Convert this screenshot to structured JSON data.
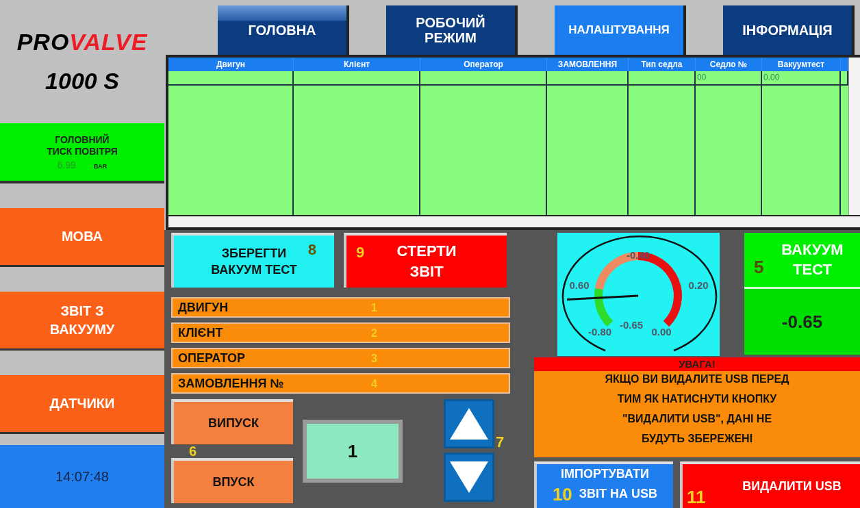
{
  "logo": {
    "brand_prefix": "PRO",
    "brand_suffix": "VALVE",
    "model": "1000 S"
  },
  "nav": [
    {
      "label": "ГОЛОВНА",
      "selected": false
    },
    {
      "label": "РОБОЧИЙ\nРЕЖИМ",
      "selected": false
    },
    {
      "label": "НАЛАШТУВАННЯ",
      "selected": true
    },
    {
      "label": "ІНФОРМАЦІЯ",
      "selected": false
    }
  ],
  "pressure": {
    "title": "ГОЛОВНИЙ\nТИСК ПОВІТРЯ",
    "value": "6.99",
    "unit": "BAR"
  },
  "side_buttons": [
    {
      "label": "МОВА"
    },
    {
      "label": "ЗВІТ З\nВАКУУМУ"
    },
    {
      "label": "ДАТЧИКИ"
    }
  ],
  "clock": "14:07:48",
  "table": {
    "columns": [
      {
        "header": "Двигун"
      },
      {
        "header": "Клієнт"
      },
      {
        "header": "Оператор"
      },
      {
        "header": "ЗАМОВЛЕННЯ"
      },
      {
        "header": "Тип седла"
      },
      {
        "header": "Седло №",
        "cells": [
          "00"
        ]
      },
      {
        "header": "Вакуумтест",
        "cells": [
          "0.00"
        ]
      }
    ]
  },
  "actions": [
    {
      "kind": "save",
      "label": "ЗБЕРЕГТИ\nВАКУУМ ТЕСТ",
      "marker": "8"
    },
    {
      "kind": "erase",
      "label": "СТЕРТИ\nЗВІТ",
      "marker": "9"
    }
  ],
  "fields": [
    {
      "label": "ДВИГУН",
      "marker": "1"
    },
    {
      "label": "КЛІЄНТ",
      "marker": "2"
    },
    {
      "label": "ОПЕРАТОР",
      "marker": "3"
    },
    {
      "label": "ЗАМОВЛЕННЯ №",
      "marker": "4"
    }
  ],
  "valves": [
    {
      "label": "ВИПУСК",
      "marker": "6"
    },
    {
      "label": "ВПУСК"
    }
  ],
  "counter": {
    "value": "1",
    "marker": "7"
  },
  "gauge": {
    "ticks": [
      "-0.40",
      "0.60",
      "0.20",
      "-0.80",
      "0.00"
    ],
    "reading": "-0.65"
  },
  "vacuum_test": {
    "label": "ВАКУУМ\nТЕСТ",
    "marker": "5",
    "value": "-0.65"
  },
  "warning": {
    "title": "УВАГА!",
    "message": "ЯКЩО ВИ ВИДАЛИТЕ USB ПЕРЕД ТИМ ЯК НАТИСНУТИ КНОПКУ \"ВИДАЛИТИ USB\", ДАНІ НЕ БУДУТЬ ЗБЕРЕЖЕНІ"
  },
  "usb_buttons": [
    {
      "kind": "import",
      "label": "ІМПОРТУВАТИ\nЗВІТ НА USB",
      "marker": "10"
    },
    {
      "kind": "remove",
      "label": "ВИДАЛИТИ USB",
      "marker": "11"
    }
  ]
}
